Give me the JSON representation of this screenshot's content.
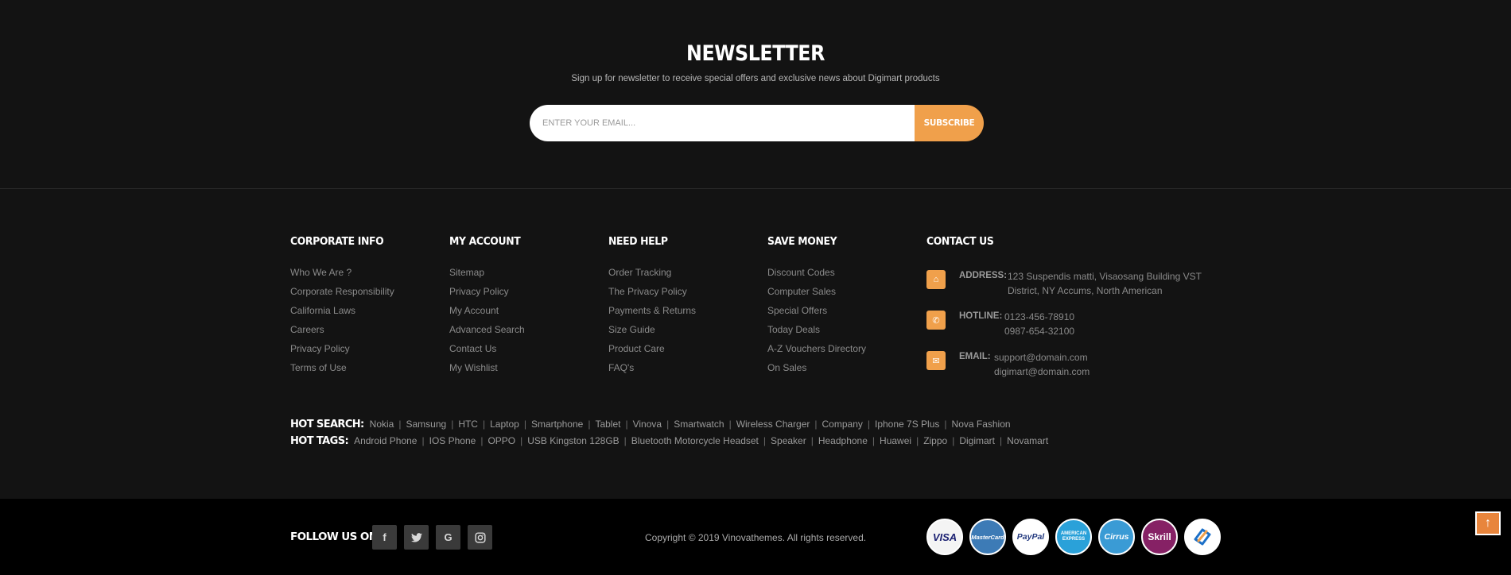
{
  "newsletter": {
    "title": "NEWSLETTER",
    "subtitle": "Sign up for newsletter to receive special offers and exclusive news about Digimart products",
    "email_placeholder": "ENTER YOUR EMAIL...",
    "subscribe_label": "SUBSCRIBE"
  },
  "columns": {
    "corporate": {
      "title": "CORPORATE INFO",
      "items": [
        "Who We Are ?",
        "Corporate Responsibility",
        "California Laws",
        "Careers",
        "Privacy Policy",
        "Terms of Use"
      ]
    },
    "account": {
      "title": "MY ACCOUNT",
      "items": [
        "Sitemap",
        "Privacy Policy",
        "My Account",
        "Advanced Search",
        "Contact Us",
        "My Wishlist"
      ]
    },
    "help": {
      "title": "NEED HELP",
      "items": [
        "Order Tracking",
        "The Privacy Policy",
        "Payments & Returns",
        "Size Guide",
        "Product Care",
        "FAQ's"
      ]
    },
    "save": {
      "title": "SAVE MONEY",
      "items": [
        "Discount Codes",
        "Computer Sales",
        "Special Offers",
        "Today Deals",
        "A-Z Vouchers Directory",
        "On Sales"
      ]
    }
  },
  "contact": {
    "title": "CONTACT US",
    "address_label": "ADDRESS:",
    "address_line1": "123 Suspendis matti, Visaosang Building VST",
    "address_line2": "District, NY Accums, North American",
    "hotline_label": "HOTLINE:",
    "hotline_1": "0123-456-78910",
    "hotline_2": "0987-654-32100",
    "email_label": "EMAIL:",
    "email_1": "support@domain.com",
    "email_2": "digimart@domain.com",
    "icons": [
      "home-icon",
      "phone-icon",
      "envelope-icon"
    ],
    "icon_color": "#f0a04b"
  },
  "hot_search": {
    "label": "HOT SEARCH:",
    "items": [
      "Nokia",
      "Samsung",
      "HTC",
      "Laptop",
      "Smartphone",
      "Tablet",
      "Vinova",
      "Smartwatch",
      "Wireless Charger",
      "Company",
      "Iphone 7S Plus",
      "Nova Fashion"
    ]
  },
  "hot_tags": {
    "label": "HOT TAGS:",
    "items": [
      "Android Phone",
      "IOS Phone",
      "OPPO",
      "USB Kingston 128GB",
      "Bluetooth Motorcycle Headset",
      "Speaker",
      "Headphone",
      "Huawei",
      "Zippo",
      "Digimart",
      "Novamart"
    ]
  },
  "bottom": {
    "follow_label": "FOLLOW US ON:",
    "social": [
      {
        "name": "facebook-icon",
        "glyph": "f"
      },
      {
        "name": "twitter-icon",
        "glyph": "🐦"
      },
      {
        "name": "google-icon",
        "glyph": "G"
      },
      {
        "name": "instagram-icon",
        "glyph": "◎"
      }
    ],
    "copyright": "Copyright © 2019 Vinovathemes. All rights reserved.",
    "payments": [
      {
        "name": "visa-icon",
        "label": "VISA",
        "bg": "#f4f4f4",
        "fg": "#1a1f71"
      },
      {
        "name": "mastercard-icon",
        "label": "MasterCard",
        "bg": "#3d7bb6",
        "fg": "#ffffff"
      },
      {
        "name": "paypal-icon",
        "label": "PayPal",
        "bg": "#ffffff",
        "fg": "#253b80"
      },
      {
        "name": "american-express-icon",
        "label": "AMERICAN EXPRESS",
        "bg": "#2aa1d9",
        "fg": "#ffffff"
      },
      {
        "name": "cirrus-icon",
        "label": "Cirrus",
        "bg": "#3a9bd5",
        "fg": "#ffffff"
      },
      {
        "name": "skrill-icon",
        "label": "Skrill",
        "bg": "#862165",
        "fg": "#ffffff"
      },
      {
        "name": "ebay-pay-icon",
        "label": "",
        "bg": "#ffffff",
        "fg": "#1c70c8"
      }
    ],
    "scroll_top_glyph": "↑"
  }
}
